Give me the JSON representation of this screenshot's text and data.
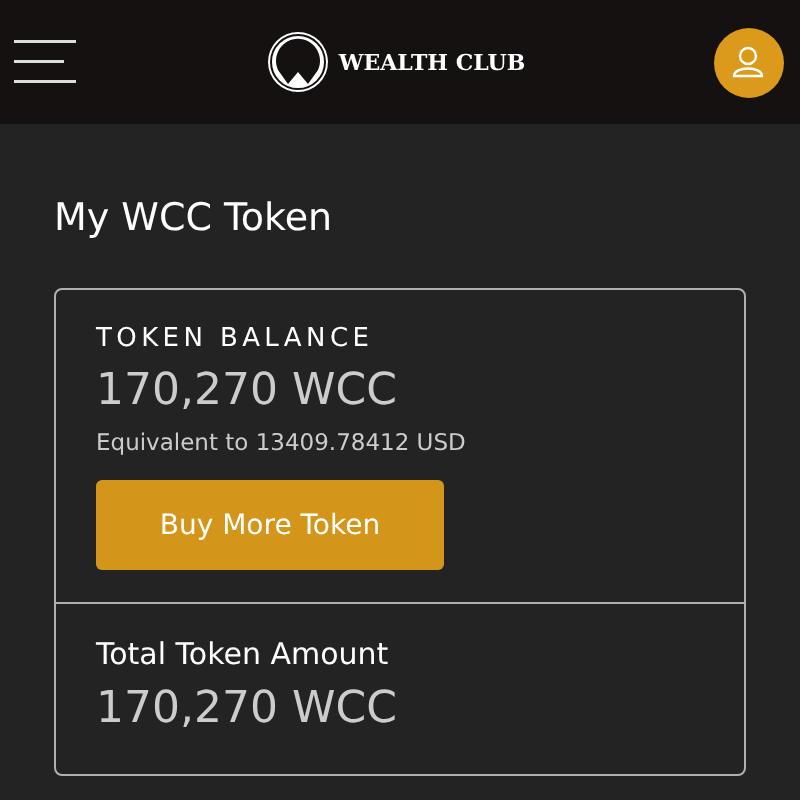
{
  "header": {
    "brand": "WEALTH CLUB"
  },
  "title": "My WCC Token",
  "balance": {
    "label": "TOKEN BALANCE",
    "amount": "170,270 WCC",
    "equivalent": "Equivalent to 13409.78412 USD",
    "button": "Buy More Token"
  },
  "total": {
    "label": "Total Token Amount",
    "amount": "170,270 WCC"
  }
}
